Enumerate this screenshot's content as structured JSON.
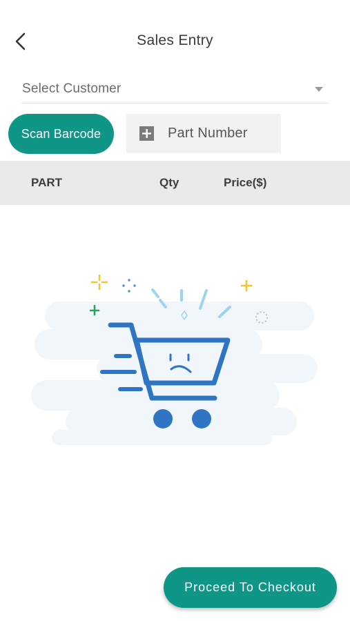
{
  "header": {
    "title": "Sales Entry",
    "back_icon": "chevron-left-icon"
  },
  "customer": {
    "placeholder": "Select Customer",
    "caret_icon": "caret-down-icon"
  },
  "actions": {
    "scan_label": "Scan Barcode",
    "part_placeholder": "Part Number",
    "part_icon": "plus-square-icon"
  },
  "table": {
    "columns": [
      "PART",
      "Qty",
      "Price($)"
    ]
  },
  "empty_state": {
    "illustration": "sad-cart-icon"
  },
  "footer": {
    "checkout_label": "Proceed To Checkout"
  },
  "colors": {
    "primary": "#0f9686",
    "table_header_bg": "#eaeaea",
    "input_bg": "#f1f2f4",
    "cart_blue": "#2f75c3"
  }
}
